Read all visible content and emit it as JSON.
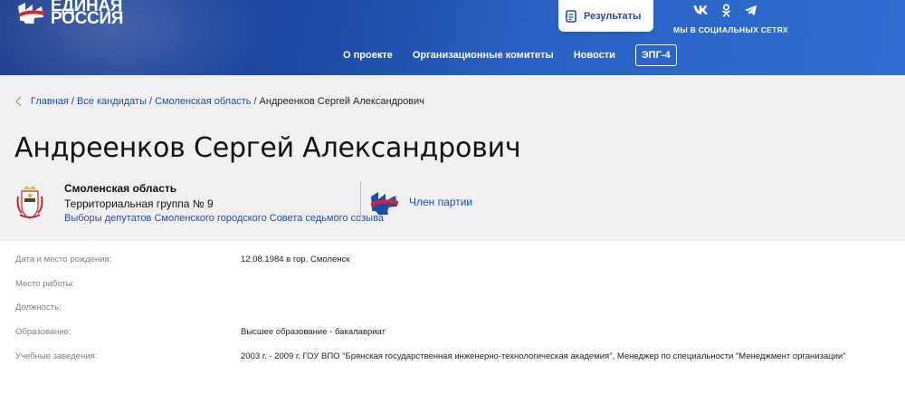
{
  "header": {
    "logo_line1": "ЕДИНАЯ",
    "logo_line2": "РОССИЯ",
    "results_label": "Результаты",
    "social_label": "МЫ В СОЦИАЛЬНЫХ СЕТЯХ",
    "social_icons": [
      "vk-icon",
      "odnoklassniki-icon",
      "telegram-icon"
    ],
    "nav": [
      "О проекте",
      "Организационные комитеты",
      "Новости"
    ],
    "nav_button": "ЭПГ-4"
  },
  "breadcrumb": {
    "items": [
      "Главная",
      "Все кандидаты",
      "Смоленская область"
    ],
    "current": "Андреенков Сергей Александрович"
  },
  "candidate": {
    "name": "Андреенков Сергей Александрович",
    "region": "Смоленская область",
    "group": "Территориальная группа № 9",
    "election": "Выборы депутатов Смоленского городского Совета седьмого созыва",
    "party_status": "Член партии"
  },
  "info": [
    {
      "label": "Дата и место рождения:",
      "value": "12.08.1984 в гор. Смоленск"
    },
    {
      "label": "Место работы:",
      "value": ""
    },
    {
      "label": "Должность:",
      "value": ""
    },
    {
      "label": "Образование:",
      "value": "Высшее образование - бакалавриат"
    },
    {
      "label": "Учебные заведения:",
      "value": "2003 г. - 2009 г. ГОУ ВПО \"Брянская государственная инженерно-технологическая академия\", Менеджер по специальности \"Менеджмент организации\""
    }
  ],
  "colors": {
    "header_blue": "#1f4aa6",
    "link_blue": "#1f4aa6",
    "grey_bg": "#f1f1f4"
  }
}
